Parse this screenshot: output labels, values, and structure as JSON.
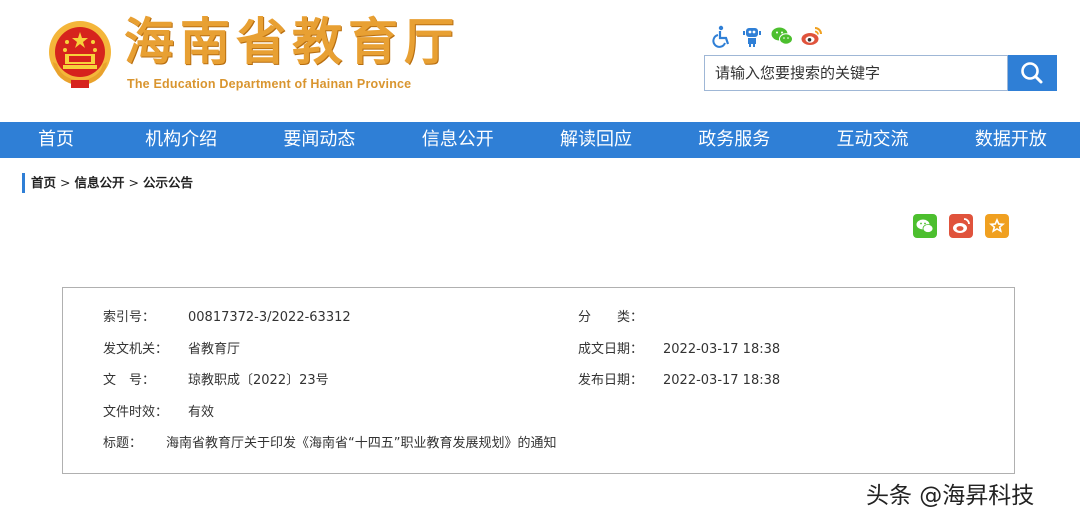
{
  "header": {
    "title": "海南省教育厅",
    "subtitle": "The Education Department of Hainan Province",
    "accessibility_icons": [
      "wheelchair-icon",
      "robot-icon",
      "wechat-icon",
      "weibo-icon"
    ]
  },
  "search": {
    "placeholder": "请输入您要搜索的关键字",
    "button_icon": "search-icon"
  },
  "nav": {
    "items": [
      "首页",
      "机构介绍",
      "要闻动态",
      "信息公开",
      "解读回应",
      "政务服务",
      "互动交流",
      "数据开放"
    ]
  },
  "breadcrumb": {
    "items": [
      "首页",
      "信息公开",
      "公示公告"
    ],
    "separator": ">"
  },
  "share_icons": [
    "wechat-share-icon",
    "weibo-share-icon",
    "favorite-star-icon"
  ],
  "info": {
    "index_label": "索引号：",
    "index_value": "00817372-3/2022-63312",
    "category_label": "分　　类：",
    "category_value": "",
    "issuer_label": "发文机关：",
    "issuer_value": "省教育厅",
    "created_label": "成文日期：",
    "created_value": "2022-03-17 18:38",
    "docno_label": "文　号：",
    "docno_value": "琼教职成〔2022〕23号",
    "published_label": "发布日期：",
    "published_value": "2022-03-17 18:38",
    "validity_label": "文件时效：",
    "validity_value": "有效",
    "title_label": "标题：",
    "title_value": "海南省教育厅关于印发《海南省“十四五”职业教育发展规划》的通知"
  },
  "watermark": "头条 @海昇科技",
  "colors": {
    "nav_blue": "#2f7fd6",
    "title_gold": "#e8a033",
    "wechat_green": "#4cbf2e",
    "weibo_red": "#e0533c",
    "star_orange": "#f0a020"
  }
}
